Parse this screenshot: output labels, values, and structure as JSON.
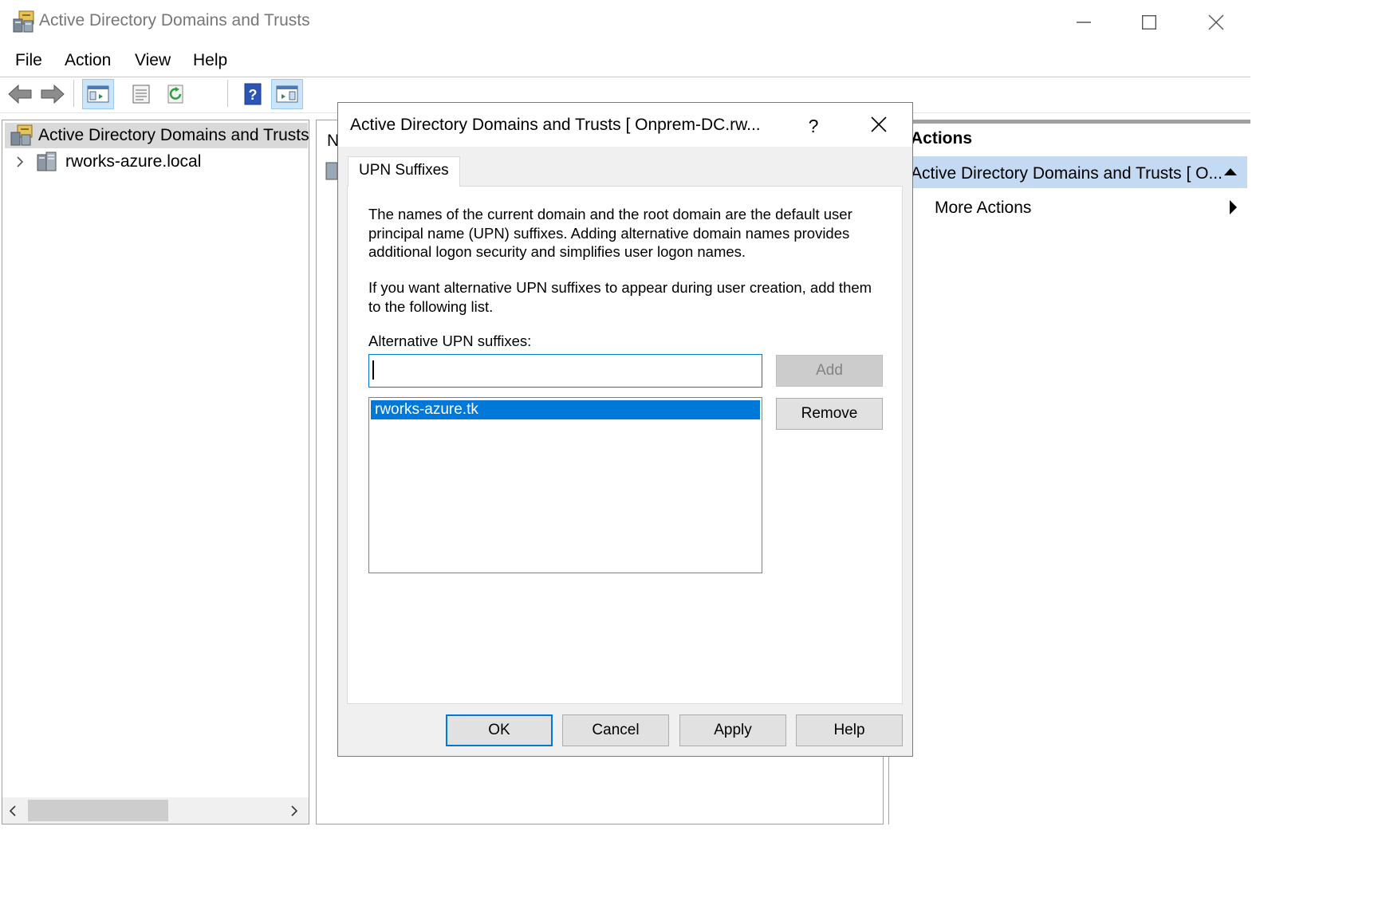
{
  "window": {
    "title": "Active Directory Domains and Trusts"
  },
  "menu": [
    "File",
    "Action",
    "View",
    "Help"
  ],
  "tree": {
    "root": "Active Directory Domains and Trusts",
    "child": "rworks-azure.local"
  },
  "middle": {
    "header_fragment": "N"
  },
  "actions": {
    "header": "Actions",
    "selected": "Active Directory Domains and Trusts [ O...",
    "more": "More Actions"
  },
  "dialog": {
    "title": "Active Directory Domains and Trusts [ Onprem-DC.rw...",
    "help_glyph": "?",
    "tab": "UPN Suffixes",
    "para1": "The names of the current domain and the root domain are the default user principal name (UPN) suffixes. Adding alternative domain names provides additional logon security and simplifies user logon names.",
    "para2": "If you want alternative UPN suffixes to appear during user creation, add them to the following list.",
    "alt_label": "Alternative UPN suffixes:",
    "input_value": "",
    "suffixes": [
      "rworks-azure.tk"
    ],
    "buttons": {
      "add": "Add",
      "remove": "Remove",
      "ok": "OK",
      "cancel": "Cancel",
      "apply": "Apply",
      "help": "Help"
    }
  },
  "icons": {
    "app": "ad-domains-trusts-icon",
    "domain": "domain-server-icon",
    "back": "back-arrow-icon",
    "forward": "forward-arrow-icon",
    "accent": "#0078d7"
  }
}
